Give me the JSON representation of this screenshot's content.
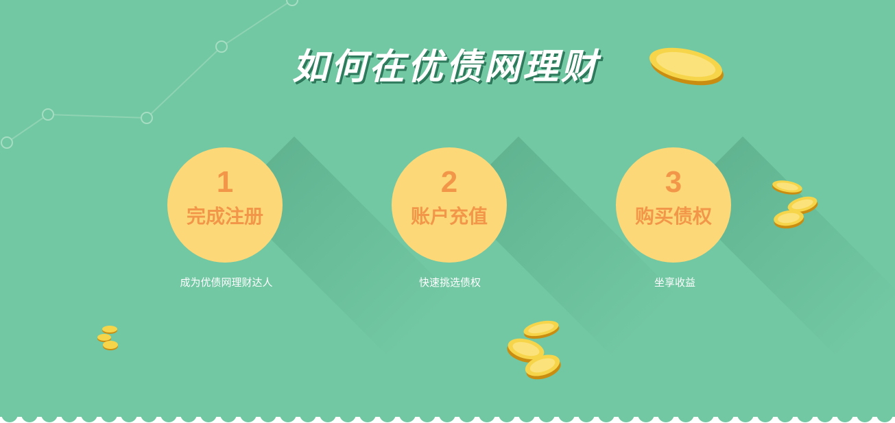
{
  "title": "如何在优债网理财",
  "steps": [
    {
      "number": "1",
      "title": "完成注册",
      "description": "成为优债网理财达人"
    },
    {
      "number": "2",
      "title": "账户充值",
      "description": "快速挑选债权"
    },
    {
      "number": "3",
      "title": "购买债权",
      "description": "坐享收益"
    }
  ],
  "colors": {
    "background": "#72c8a3",
    "circle": "#fdd878",
    "step_text": "#f2974a",
    "title_text": "#ffffff"
  }
}
